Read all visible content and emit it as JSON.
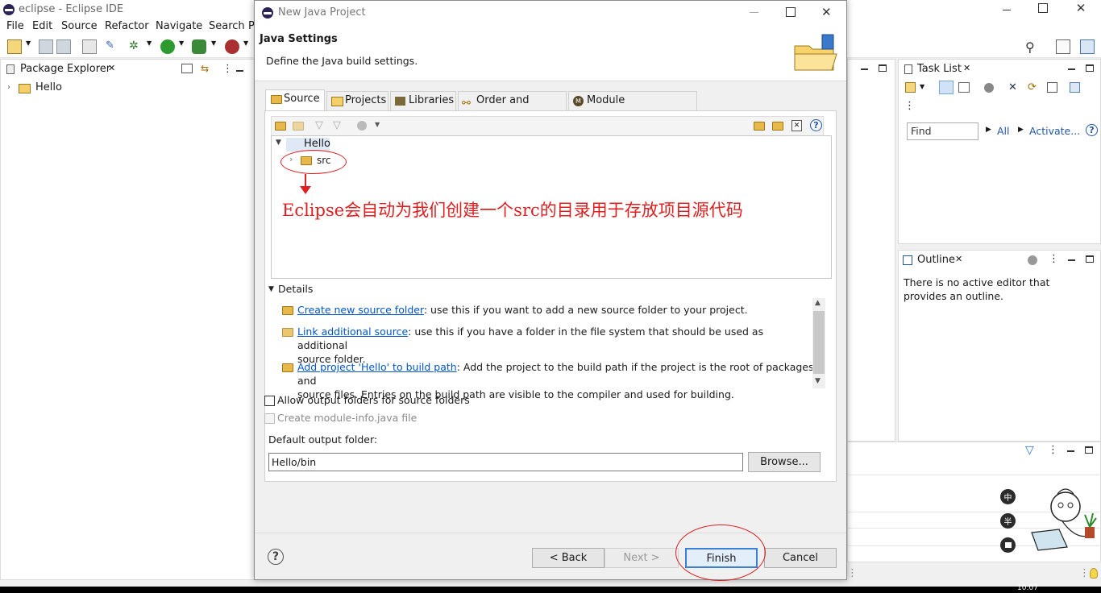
{
  "window": {
    "title": "eclipse - Eclipse IDE"
  },
  "menu": [
    "File",
    "Edit",
    "Source",
    "Refactor",
    "Navigate",
    "Search",
    "P"
  ],
  "package_explorer": {
    "tab": "Package Explorer",
    "items": [
      "Hello"
    ]
  },
  "task_list": {
    "tab": "Task List",
    "find_placeholder": "Find",
    "all_link": "All",
    "activate_link": "Activate..."
  },
  "outline": {
    "tab": "Outline",
    "message": "There is no active editor that provides an outline."
  },
  "dialog": {
    "title": "New Java Project",
    "heading": "Java Settings",
    "subheading": "Define the Java build settings.",
    "tabs": [
      "Source",
      "Projects",
      "Libraries",
      "Order and Export",
      "Module Dependencies"
    ],
    "tree": {
      "project": "Hello",
      "folder": "src"
    },
    "annotation": "Eclipse会自动为我们创建一个src的目录用于存放项目源代码",
    "details_label": "Details",
    "details": [
      {
        "link": "Create new source folder",
        "text": ": use this if you want to add a new source folder to your project.",
        "text2": ""
      },
      {
        "link": "Link additional source",
        "text": ": use this if you have a folder in the file system that should be used as additional",
        "text2": "source folder."
      },
      {
        "link": "Add project 'Hello' to build path",
        "text": ": Add the project to the build path if the project is the root of packages and",
        "text2": "source files. Entries on the build path are visible to the compiler and used for building."
      }
    ],
    "allow_output_label": "Allow output folders for source folders",
    "module_info_label": "Create module-info.java file",
    "output_folder_label": "Default output folder:",
    "output_folder_value": "Hello/bin",
    "browse": "Browse...",
    "back": "< Back",
    "next": "Next >",
    "finish": "Finish",
    "cancel": "Cancel"
  },
  "taskbar_fragment": "10:07",
  "badges": [
    "中",
    "半"
  ]
}
